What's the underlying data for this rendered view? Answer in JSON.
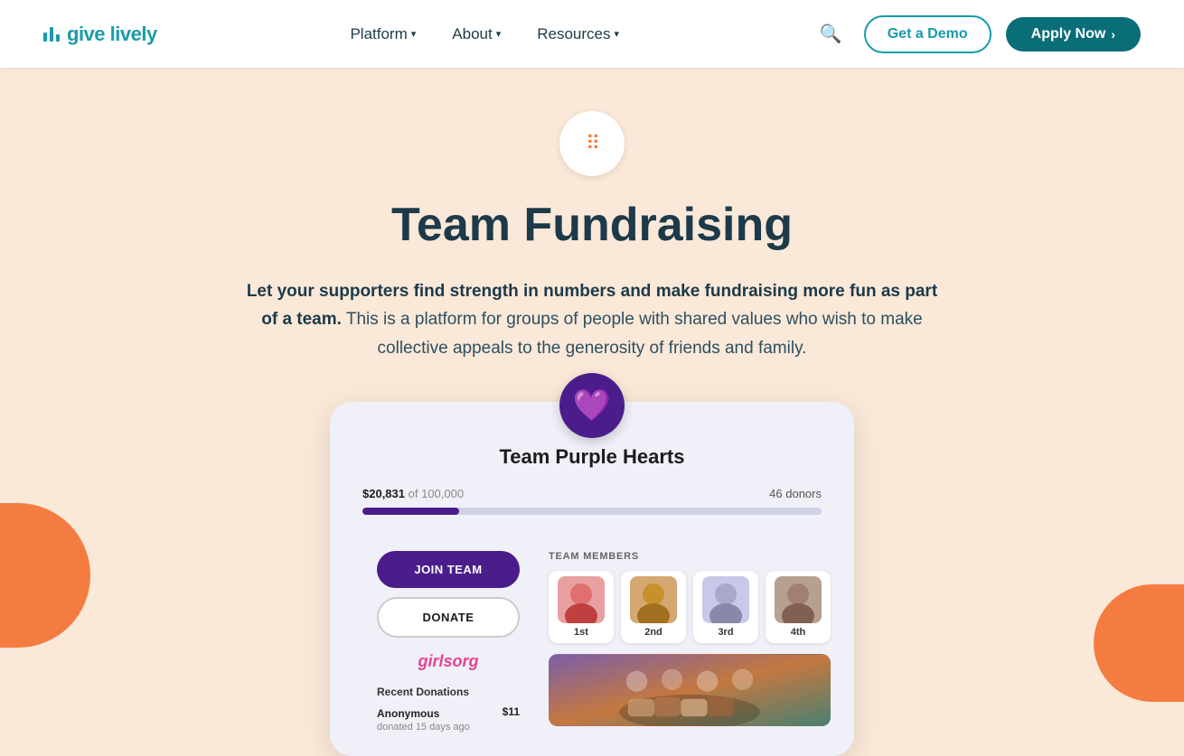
{
  "logo": {
    "text": "give lively"
  },
  "navbar": {
    "links": [
      {
        "label": "Platform",
        "has_dropdown": true
      },
      {
        "label": "About",
        "has_dropdown": true
      },
      {
        "label": "Resources",
        "has_dropdown": true
      }
    ],
    "cta_demo": "Get a Demo",
    "cta_apply": "Apply Now"
  },
  "hero": {
    "icon_symbol": "··:",
    "title": "Team Fundraising",
    "description_bold": "Let your supporters find strength in numbers and make fundraising more fun as part of a team.",
    "description_regular": " This is a platform for groups of people with shared values who wish to make collective appeals to the generosity of friends and family."
  },
  "card": {
    "team_name": "Team Purple Hearts",
    "amount": "$20,831",
    "goal": "of 100,000",
    "donors": "46 donors",
    "progress_pct": 21,
    "btn_join": "JOIN TEAM",
    "btn_donate": "DONATE",
    "org_name": "girlsorg",
    "recent_label": "Recent Donations",
    "donations": [
      {
        "name": "Anonymous",
        "date": "donated 15 days ago",
        "amount": "$11"
      }
    ],
    "team_members_label": "TEAM MEMBERS",
    "members": [
      {
        "rank": "1st",
        "emoji": "👩"
      },
      {
        "rank": "2nd",
        "emoji": "👨"
      },
      {
        "rank": "3rd",
        "emoji": "👩"
      },
      {
        "rank": "4th",
        "emoji": "👩"
      }
    ]
  }
}
